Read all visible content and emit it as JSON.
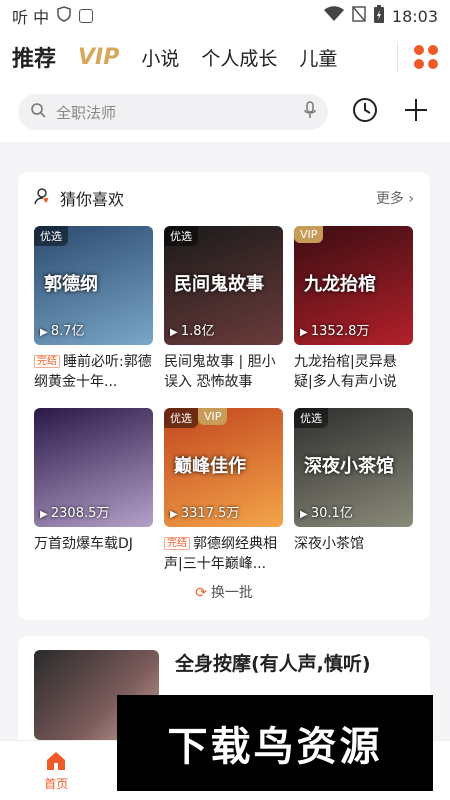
{
  "status": {
    "app_glyphs": "听 中",
    "time": "18:03",
    "icons": [
      "shield-icon",
      "app-a-icon",
      "wifi-icon",
      "no-sim-icon",
      "battery-charging-icon"
    ]
  },
  "nav": {
    "tabs": [
      "推荐",
      "VIP",
      "小说",
      "个人成长",
      "儿童"
    ],
    "active": "推荐"
  },
  "search": {
    "placeholder": "全职法师"
  },
  "recommend": {
    "title": "猜你喜欢",
    "more": "更多",
    "refresh": "换一批",
    "items": [
      {
        "badge": "优选",
        "vip": "",
        "plays": "8.7亿",
        "done": "完结",
        "title": "睡前必听:郭德纲黄金十年...",
        "art": "郭德纲",
        "colors": [
          "#2b4a6e",
          "#7aa6c8"
        ]
      },
      {
        "badge": "优选",
        "vip": "",
        "plays": "1.8亿",
        "done": "",
        "title": "民间鬼故事 | 胆小误入 恐怖故事",
        "art": "民间鬼故事",
        "colors": [
          "#1a1a1a",
          "#6b3b3b"
        ]
      },
      {
        "badge": "",
        "vip": "VIP",
        "plays": "1352.8万",
        "done": "",
        "title": "九龙抬棺|灵异悬疑|多人有声小说",
        "art": "九龙抬棺",
        "colors": [
          "#3a0d12",
          "#b3202a"
        ]
      },
      {
        "badge": "",
        "vip": "",
        "plays": "2308.5万",
        "done": "",
        "title": "万首劲爆车载DJ",
        "art": "",
        "colors": [
          "#2a1848",
          "#b4a0c8"
        ]
      },
      {
        "badge": "优选",
        "vip": "VIP",
        "plays": "3317.5万",
        "done": "完结",
        "title": "郭德纲经典相声|三十年巅峰...",
        "art": "巅峰佳作",
        "colors": [
          "#c2451e",
          "#f3a54a"
        ]
      },
      {
        "badge": "优选",
        "vip": "",
        "plays": "30.1亿",
        "done": "",
        "title": "深夜小茶馆",
        "art": "深夜小茶馆",
        "colors": [
          "#2e2e2e",
          "#8a8a7a"
        ]
      }
    ]
  },
  "next_card": {
    "title": "全身按摩(有人声,慎听)"
  },
  "bottom_nav": {
    "items": [
      "首页",
      "",
      "",
      ""
    ],
    "active": "首页"
  },
  "watermark": {
    "text": "下载鸟资源"
  }
}
